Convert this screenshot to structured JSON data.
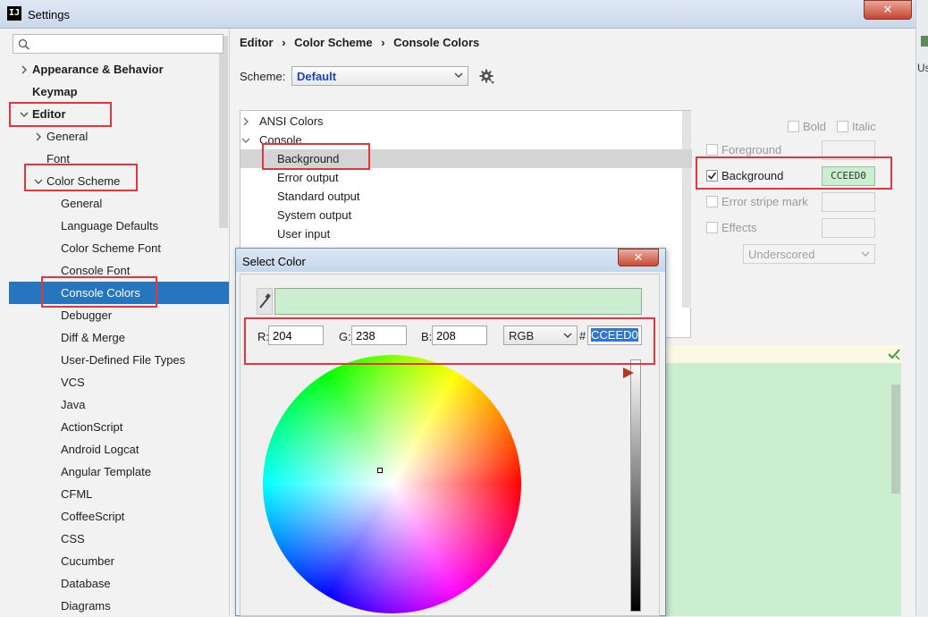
{
  "window": {
    "title": "Settings",
    "app_icon": "IJ",
    "close_glyph": "✕",
    "right_edge_text": "Us"
  },
  "sidebar": {
    "search_placeholder": "",
    "items": [
      {
        "label": "Appearance & Behavior",
        "level": 0,
        "bold": true,
        "chevron": "right"
      },
      {
        "label": "Keymap",
        "level": 0,
        "bold": true,
        "chevron": "none"
      },
      {
        "label": "Editor",
        "level": 0,
        "bold": true,
        "chevron": "down"
      },
      {
        "label": "General",
        "level": 1,
        "bold": false,
        "chevron": "right"
      },
      {
        "label": "Font",
        "level": 1,
        "bold": false,
        "chevron": "none"
      },
      {
        "label": "Color Scheme",
        "level": 1,
        "bold": false,
        "chevron": "down"
      },
      {
        "label": "General",
        "level": 2,
        "bold": false,
        "chevron": "none"
      },
      {
        "label": "Language Defaults",
        "level": 2,
        "bold": false,
        "chevron": "none"
      },
      {
        "label": "Color Scheme Font",
        "level": 2,
        "bold": false,
        "chevron": "none"
      },
      {
        "label": "Console Font",
        "level": 2,
        "bold": false,
        "chevron": "none"
      },
      {
        "label": "Console Colors",
        "level": 2,
        "bold": false,
        "chevron": "none",
        "selected": true
      },
      {
        "label": "Debugger",
        "level": 2,
        "bold": false,
        "chevron": "none"
      },
      {
        "label": "Diff & Merge",
        "level": 2,
        "bold": false,
        "chevron": "none"
      },
      {
        "label": "User-Defined File Types",
        "level": 2,
        "bold": false,
        "chevron": "none"
      },
      {
        "label": "VCS",
        "level": 2,
        "bold": false,
        "chevron": "none"
      },
      {
        "label": "Java",
        "level": 2,
        "bold": false,
        "chevron": "none"
      },
      {
        "label": "ActionScript",
        "level": 2,
        "bold": false,
        "chevron": "none"
      },
      {
        "label": "Android Logcat",
        "level": 2,
        "bold": false,
        "chevron": "none"
      },
      {
        "label": "Angular Template",
        "level": 2,
        "bold": false,
        "chevron": "none"
      },
      {
        "label": "CFML",
        "level": 2,
        "bold": false,
        "chevron": "none"
      },
      {
        "label": "CoffeeScript",
        "level": 2,
        "bold": false,
        "chevron": "none"
      },
      {
        "label": "CSS",
        "level": 2,
        "bold": false,
        "chevron": "none"
      },
      {
        "label": "Cucumber",
        "level": 2,
        "bold": false,
        "chevron": "none"
      },
      {
        "label": "Database",
        "level": 2,
        "bold": false,
        "chevron": "none"
      },
      {
        "label": "Diagrams",
        "level": 2,
        "bold": false,
        "chevron": "none"
      }
    ]
  },
  "breadcrumb": [
    "Editor",
    "›",
    "Color Scheme",
    "›",
    "Console Colors"
  ],
  "scheme": {
    "label": "Scheme:",
    "value": "Default"
  },
  "console_tree": [
    {
      "label": "ANSI Colors",
      "chevron": "right"
    },
    {
      "label": "Console",
      "chevron": "down"
    },
    {
      "label": "Background",
      "selected": true
    },
    {
      "label": "Error output"
    },
    {
      "label": "Standard output"
    },
    {
      "label": "System output"
    },
    {
      "label": "User input"
    }
  ],
  "attributes": {
    "bold_label": "Bold",
    "italic_label": "Italic",
    "foreground_label": "Foreground",
    "background_label": "Background",
    "background_checked": true,
    "background_hex": "CCEED0",
    "error_stripe_label": "Error stripe mark",
    "effects_label": "Effects",
    "effects_value": "Underscored"
  },
  "color_dialog": {
    "title": "Select Color",
    "close_glyph": "✕",
    "r_label": "R:",
    "r_value": "204",
    "g_label": "G:",
    "g_value": "238",
    "b_label": "B:",
    "b_value": "208",
    "mode": "RGB",
    "hash": "#",
    "hex": "CCEED0",
    "brightness_level": 0.95
  },
  "colors": {
    "selection": "#2675bf",
    "chosen_color": "#cceed0",
    "annotation_red": "#e3353b"
  }
}
